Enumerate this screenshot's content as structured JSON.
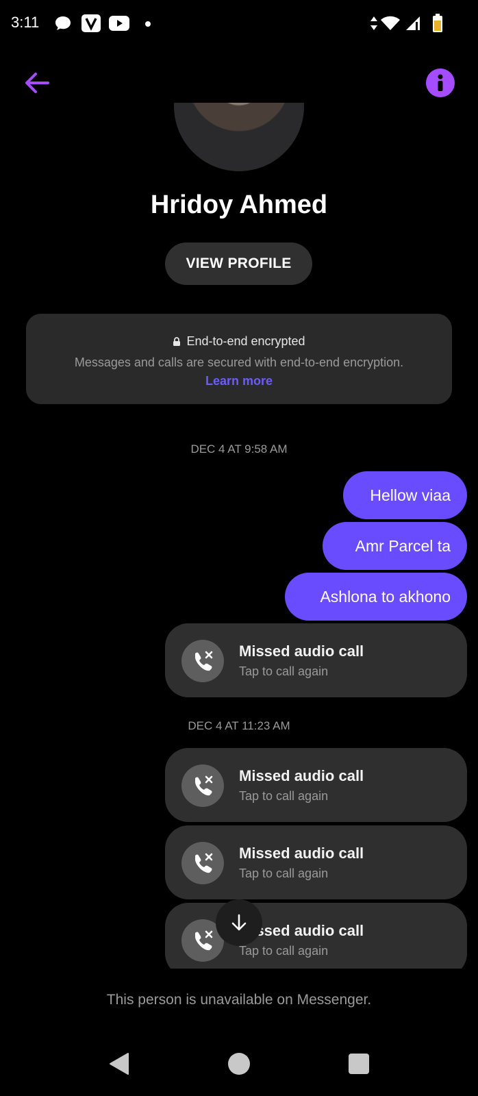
{
  "status_bar": {
    "time": "3:11",
    "icons": [
      "chat-bubble-icon",
      "v-app-icon",
      "youtube-icon",
      "dot-icon",
      "data-arrows-icon",
      "wifi-icon",
      "signal-icon",
      "battery-icon"
    ]
  },
  "header": {
    "back_icon": "arrow-left-icon",
    "info_icon": "info-icon",
    "accent_color": "#a64cff"
  },
  "profile": {
    "name": "Hridoy Ahmed",
    "view_profile_label": "VIEW PROFILE"
  },
  "encryption": {
    "title": "End-to-end encrypted",
    "description": "Messages and calls are secured with end-to-end encryption.",
    "learn_more": "Learn more"
  },
  "timestamps": [
    "DEC 4 AT 9:58 AM",
    "DEC 4 AT 11:23 AM"
  ],
  "messages": [
    {
      "text": "Hellow viaa"
    },
    {
      "text": "Amr Parcel ta"
    },
    {
      "text": "Ashlona to akhono"
    }
  ],
  "calls": [
    {
      "title": "Missed audio call",
      "subtitle": "Tap to call again"
    },
    {
      "title": "Missed audio call",
      "subtitle": "Tap to call again"
    },
    {
      "title": "Missed audio call",
      "subtitle": "Tap to call again"
    },
    {
      "title": "Missed audio call",
      "subtitle": "Tap to call again"
    }
  ],
  "footer": {
    "unavailable_text": "This person is unavailable on Messenger."
  },
  "colors": {
    "bubble": "#6a4cff",
    "card": "#2f2f2f",
    "link": "#6a5cff"
  }
}
